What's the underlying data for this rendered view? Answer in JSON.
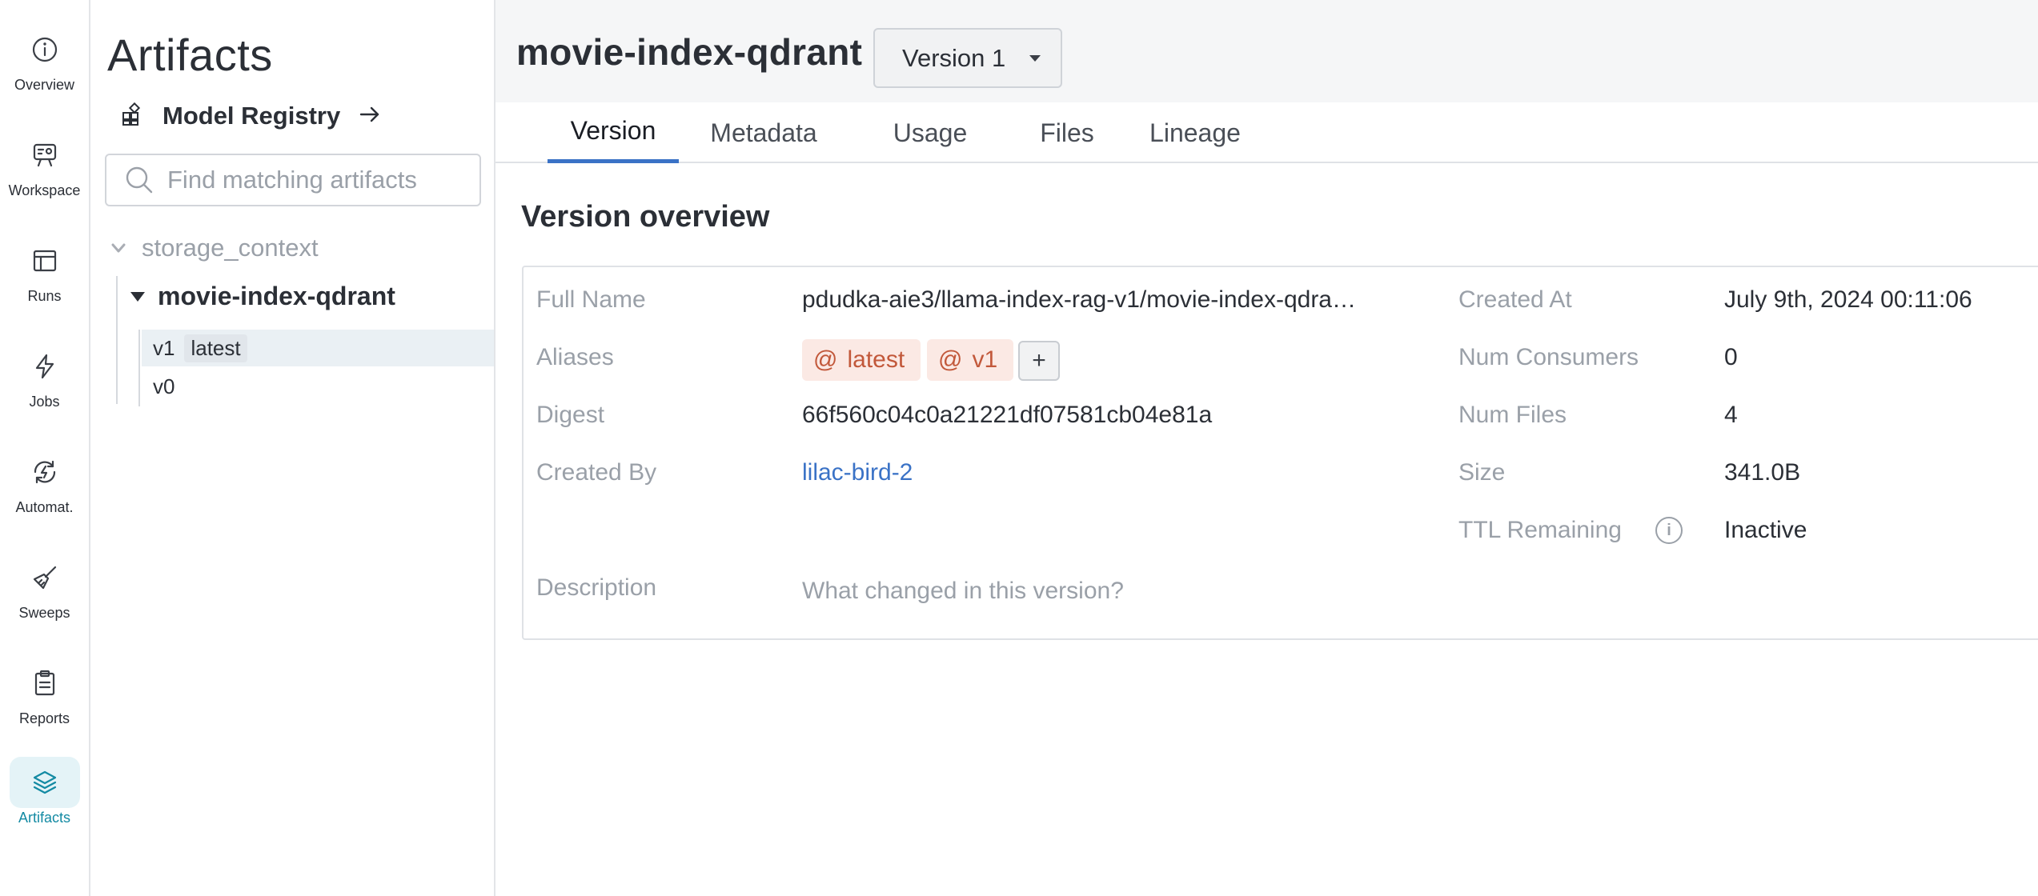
{
  "nav": {
    "items": [
      {
        "label": "Overview",
        "icon": "info-icon"
      },
      {
        "label": "Workspace",
        "icon": "workspace-icon"
      },
      {
        "label": "Runs",
        "icon": "table-icon"
      },
      {
        "label": "Jobs",
        "icon": "lightning-icon"
      },
      {
        "label": "Automat.",
        "icon": "automation-icon"
      },
      {
        "label": "Sweeps",
        "icon": "broom-icon"
      },
      {
        "label": "Reports",
        "icon": "clipboard-icon"
      },
      {
        "label": "Artifacts",
        "icon": "layers-icon"
      }
    ],
    "active": "Artifacts",
    "accent_color": "#138aa3"
  },
  "sidebar": {
    "title": "Artifacts",
    "registry_label": "Model Registry",
    "search_placeholder": "Find matching artifacts",
    "tree": {
      "type_name": "storage_context",
      "collection": "movie-index-qdrant",
      "versions": [
        {
          "label": "v1",
          "tag": "latest",
          "selected": true
        },
        {
          "label": "v0",
          "tag": "",
          "selected": false
        }
      ]
    }
  },
  "header": {
    "artifact_name": "movie-index-qdrant",
    "version_select": "Version 1"
  },
  "tabs": [
    "Version",
    "Metadata",
    "Usage",
    "Files",
    "Lineage"
  ],
  "active_tab": "Version",
  "overview": {
    "title": "Version overview",
    "full_name_label": "Full Name",
    "full_name": "pdudka-aie3/llama-index-rag-v1/movie-index-qdra…",
    "aliases_label": "Aliases",
    "aliases": [
      "latest",
      "v1"
    ],
    "alias_add": "+",
    "digest_label": "Digest",
    "digest": "66f560c04c0a21221df07581cb04e81a",
    "created_by_label": "Created By",
    "created_by": "lilac-bird-2",
    "description_label": "Description",
    "description_placeholder": "What changed in this version?",
    "created_at_label": "Created At",
    "created_at": "July 9th, 2024 00:11:06",
    "num_consumers_label": "Num Consumers",
    "num_consumers": "0",
    "num_files_label": "Num Files",
    "num_files": "4",
    "size_label": "Size",
    "size": "341.0B",
    "ttl_label": "TTL Remaining",
    "ttl": "Inactive",
    "ttl_info_glyph": "i"
  }
}
